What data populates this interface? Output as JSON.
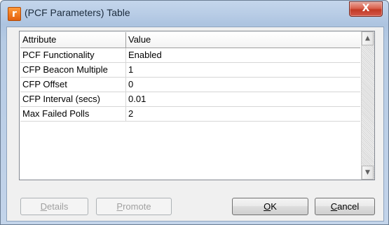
{
  "window": {
    "title": "(PCF Parameters) Table",
    "app_icon_glyph": "r",
    "close_glyph": "X"
  },
  "table": {
    "columns": [
      "Attribute",
      "Value"
    ],
    "rows": [
      {
        "attribute": "PCF Functionality",
        "value": "Enabled"
      },
      {
        "attribute": "CFP Beacon Multiple",
        "value": "1"
      },
      {
        "attribute": "CFP Offset",
        "value": "0"
      },
      {
        "attribute": "CFP Interval (secs)",
        "value": "0.01"
      },
      {
        "attribute": "Max Failed Polls",
        "value": "2"
      }
    ]
  },
  "scrollbar": {
    "up_glyph": "▲",
    "down_glyph": "▼"
  },
  "buttons": {
    "details": {
      "accel": "D",
      "rest": "etails",
      "enabled": false
    },
    "promote": {
      "accel": "P",
      "rest": "romote",
      "enabled": false
    },
    "ok": {
      "accel": "O",
      "rest": "K",
      "enabled": true
    },
    "cancel": {
      "accel": "C",
      "rest": "ancel",
      "enabled": true
    }
  },
  "colors": {
    "frame": "#b9cde6",
    "close_button": "#c23a25",
    "app_icon": "#e2600d"
  }
}
